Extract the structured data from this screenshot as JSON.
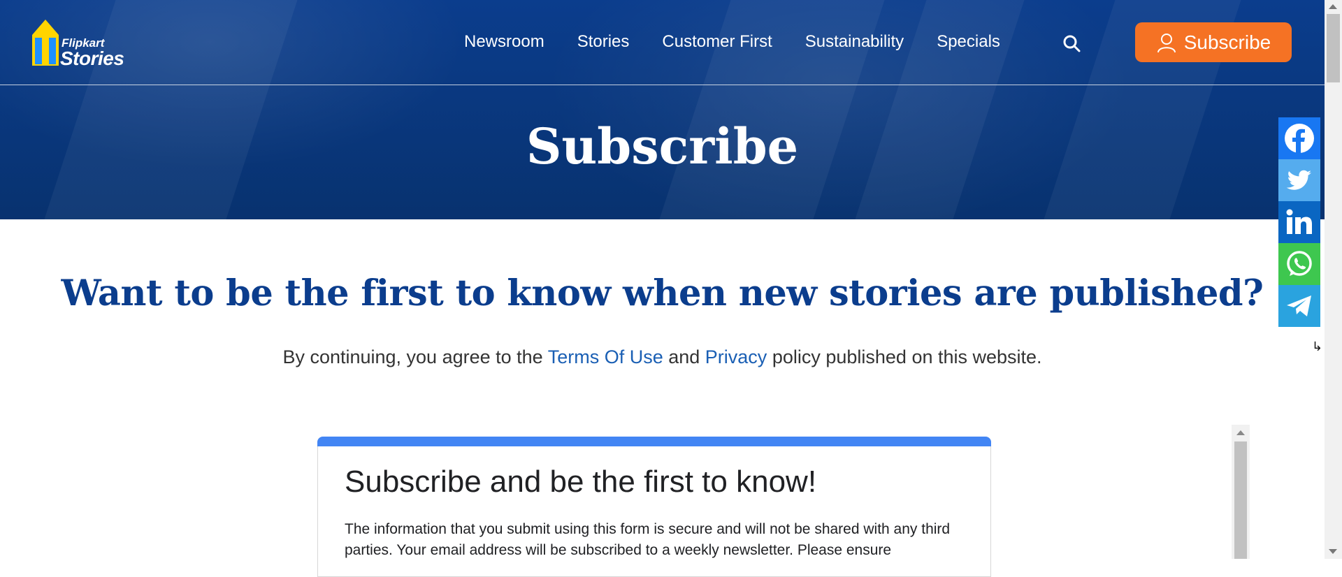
{
  "brand": {
    "line1": "Flipkart",
    "line2": "Stories"
  },
  "nav": {
    "items": [
      "Newsroom",
      "Stories",
      "Customer First",
      "Sustainability",
      "Specials"
    ],
    "subscribe_label": "Subscribe"
  },
  "hero": {
    "title": "Subscribe"
  },
  "main": {
    "headline": "Want to be the first to know when new stories are published?",
    "agree_prefix": "By continuing, you agree to the ",
    "terms_link": "Terms Of Use",
    "and": " and ",
    "privacy_link": "Privacy",
    "agree_suffix": " policy published on this website."
  },
  "form": {
    "title": "Subscribe and be the first to know!",
    "description": "The information that you submit using this form is secure and will not be shared with any third parties. Your email address will be subscribed to a weekly newsletter. Please ensure"
  },
  "share": {
    "colors": {
      "facebook": "#1877f2",
      "twitter": "#55acee",
      "linkedin": "#0a66c2",
      "whatsapp": "#3ec74f",
      "telegram": "#2aa3df"
    },
    "hide_glyph": "↳"
  },
  "colors": {
    "accent": "#f57224",
    "brand_blue": "#0b3d8d",
    "form_accent": "#4285f4"
  }
}
